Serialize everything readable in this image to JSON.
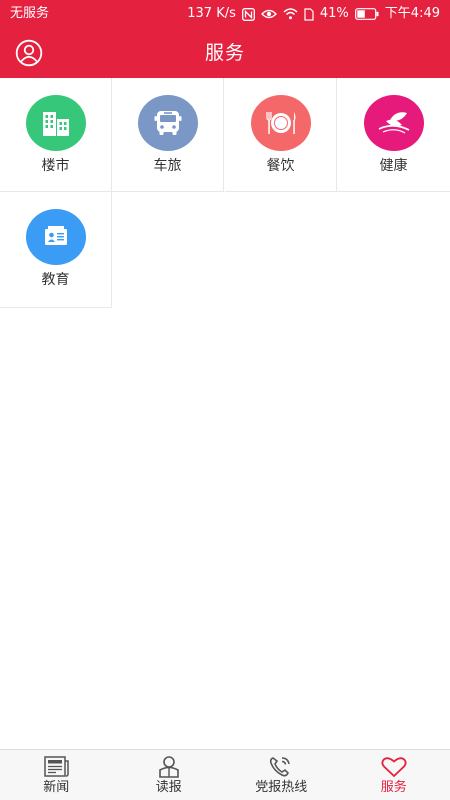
{
  "status_bar": {
    "carrier": "无服务",
    "speed": "137 K/s",
    "battery": "41%",
    "time": "下午4:49"
  },
  "header": {
    "title": "服务",
    "avatar_icon": "user-icon"
  },
  "services": [
    {
      "label": "楼市",
      "icon": "buildings-icon",
      "color": "#36c77b"
    },
    {
      "label": "车旅",
      "icon": "bus-icon",
      "color": "#7b97c6"
    },
    {
      "label": "餐饮",
      "icon": "plate-cutlery-icon",
      "color": "#f4686a"
    },
    {
      "label": "健康",
      "icon": "leaf-icon",
      "color": "#e51a7b"
    },
    {
      "label": "教育",
      "icon": "student-card-icon",
      "color": "#3b9cf5"
    }
  ],
  "tabbar": {
    "tabs": [
      {
        "label": "新闻",
        "icon": "newspaper-icon"
      },
      {
        "label": "读报",
        "icon": "reader-icon"
      },
      {
        "label": "党报热线",
        "icon": "phone-call-icon"
      },
      {
        "label": "服务",
        "icon": "heart-icon"
      }
    ],
    "active_index": 3,
    "active_color": "#e4213f"
  },
  "colors": {
    "brand": "#e4213f",
    "grid_border": "#e8e8e8",
    "tabbar_bg": "#f7f7f7"
  }
}
